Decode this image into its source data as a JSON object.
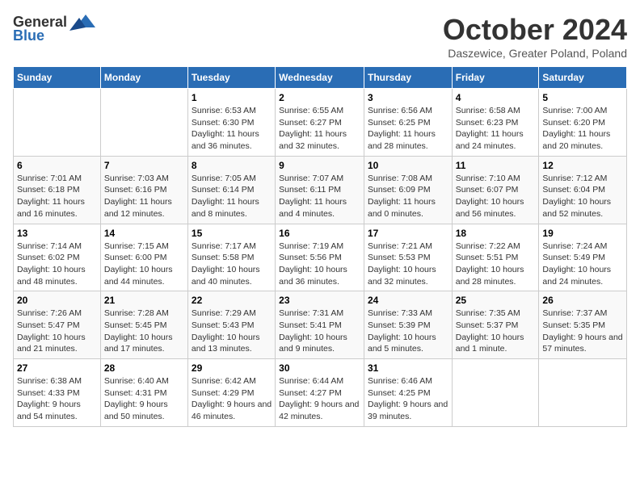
{
  "header": {
    "logo_general": "General",
    "logo_blue": "Blue",
    "title": "October 2024",
    "location": "Daszewice, Greater Poland, Poland"
  },
  "days_of_week": [
    "Sunday",
    "Monday",
    "Tuesday",
    "Wednesday",
    "Thursday",
    "Friday",
    "Saturday"
  ],
  "weeks": [
    [
      {
        "day": "",
        "info": ""
      },
      {
        "day": "",
        "info": ""
      },
      {
        "day": "1",
        "info": "Sunrise: 6:53 AM\nSunset: 6:30 PM\nDaylight: 11 hours and 36 minutes."
      },
      {
        "day": "2",
        "info": "Sunrise: 6:55 AM\nSunset: 6:27 PM\nDaylight: 11 hours and 32 minutes."
      },
      {
        "day": "3",
        "info": "Sunrise: 6:56 AM\nSunset: 6:25 PM\nDaylight: 11 hours and 28 minutes."
      },
      {
        "day": "4",
        "info": "Sunrise: 6:58 AM\nSunset: 6:23 PM\nDaylight: 11 hours and 24 minutes."
      },
      {
        "day": "5",
        "info": "Sunrise: 7:00 AM\nSunset: 6:20 PM\nDaylight: 11 hours and 20 minutes."
      }
    ],
    [
      {
        "day": "6",
        "info": "Sunrise: 7:01 AM\nSunset: 6:18 PM\nDaylight: 11 hours and 16 minutes."
      },
      {
        "day": "7",
        "info": "Sunrise: 7:03 AM\nSunset: 6:16 PM\nDaylight: 11 hours and 12 minutes."
      },
      {
        "day": "8",
        "info": "Sunrise: 7:05 AM\nSunset: 6:14 PM\nDaylight: 11 hours and 8 minutes."
      },
      {
        "day": "9",
        "info": "Sunrise: 7:07 AM\nSunset: 6:11 PM\nDaylight: 11 hours and 4 minutes."
      },
      {
        "day": "10",
        "info": "Sunrise: 7:08 AM\nSunset: 6:09 PM\nDaylight: 11 hours and 0 minutes."
      },
      {
        "day": "11",
        "info": "Sunrise: 7:10 AM\nSunset: 6:07 PM\nDaylight: 10 hours and 56 minutes."
      },
      {
        "day": "12",
        "info": "Sunrise: 7:12 AM\nSunset: 6:04 PM\nDaylight: 10 hours and 52 minutes."
      }
    ],
    [
      {
        "day": "13",
        "info": "Sunrise: 7:14 AM\nSunset: 6:02 PM\nDaylight: 10 hours and 48 minutes."
      },
      {
        "day": "14",
        "info": "Sunrise: 7:15 AM\nSunset: 6:00 PM\nDaylight: 10 hours and 44 minutes."
      },
      {
        "day": "15",
        "info": "Sunrise: 7:17 AM\nSunset: 5:58 PM\nDaylight: 10 hours and 40 minutes."
      },
      {
        "day": "16",
        "info": "Sunrise: 7:19 AM\nSunset: 5:56 PM\nDaylight: 10 hours and 36 minutes."
      },
      {
        "day": "17",
        "info": "Sunrise: 7:21 AM\nSunset: 5:53 PM\nDaylight: 10 hours and 32 minutes."
      },
      {
        "day": "18",
        "info": "Sunrise: 7:22 AM\nSunset: 5:51 PM\nDaylight: 10 hours and 28 minutes."
      },
      {
        "day": "19",
        "info": "Sunrise: 7:24 AM\nSunset: 5:49 PM\nDaylight: 10 hours and 24 minutes."
      }
    ],
    [
      {
        "day": "20",
        "info": "Sunrise: 7:26 AM\nSunset: 5:47 PM\nDaylight: 10 hours and 21 minutes."
      },
      {
        "day": "21",
        "info": "Sunrise: 7:28 AM\nSunset: 5:45 PM\nDaylight: 10 hours and 17 minutes."
      },
      {
        "day": "22",
        "info": "Sunrise: 7:29 AM\nSunset: 5:43 PM\nDaylight: 10 hours and 13 minutes."
      },
      {
        "day": "23",
        "info": "Sunrise: 7:31 AM\nSunset: 5:41 PM\nDaylight: 10 hours and 9 minutes."
      },
      {
        "day": "24",
        "info": "Sunrise: 7:33 AM\nSunset: 5:39 PM\nDaylight: 10 hours and 5 minutes."
      },
      {
        "day": "25",
        "info": "Sunrise: 7:35 AM\nSunset: 5:37 PM\nDaylight: 10 hours and 1 minute."
      },
      {
        "day": "26",
        "info": "Sunrise: 7:37 AM\nSunset: 5:35 PM\nDaylight: 9 hours and 57 minutes."
      }
    ],
    [
      {
        "day": "27",
        "info": "Sunrise: 6:38 AM\nSunset: 4:33 PM\nDaylight: 9 hours and 54 minutes."
      },
      {
        "day": "28",
        "info": "Sunrise: 6:40 AM\nSunset: 4:31 PM\nDaylight: 9 hours and 50 minutes."
      },
      {
        "day": "29",
        "info": "Sunrise: 6:42 AM\nSunset: 4:29 PM\nDaylight: 9 hours and 46 minutes."
      },
      {
        "day": "30",
        "info": "Sunrise: 6:44 AM\nSunset: 4:27 PM\nDaylight: 9 hours and 42 minutes."
      },
      {
        "day": "31",
        "info": "Sunrise: 6:46 AM\nSunset: 4:25 PM\nDaylight: 9 hours and 39 minutes."
      },
      {
        "day": "",
        "info": ""
      },
      {
        "day": "",
        "info": ""
      }
    ]
  ]
}
